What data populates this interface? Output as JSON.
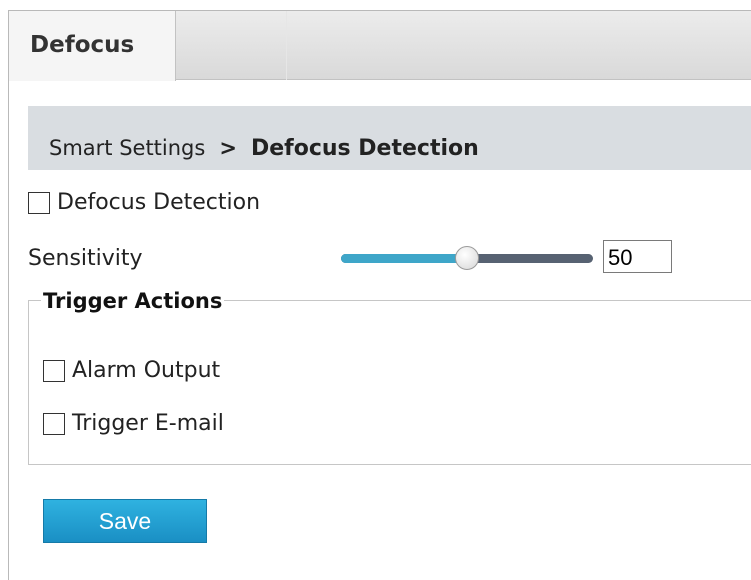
{
  "tabs": [
    {
      "label": "Defocus",
      "active": true
    }
  ],
  "breadcrumb": {
    "parent": "Smart Settings",
    "separator": ">",
    "current": "Defocus Detection"
  },
  "defocus_detection": {
    "label": "Defocus Detection",
    "checked": false
  },
  "sensitivity": {
    "label": "Sensitivity",
    "value": "50",
    "min": 0,
    "max": 100
  },
  "trigger_actions": {
    "legend": "Trigger Actions",
    "items": [
      {
        "label": "Alarm Output",
        "checked": false
      },
      {
        "label": "Trigger E-mail",
        "checked": false
      }
    ]
  },
  "save_label": "Save",
  "colors": {
    "accent": "#1a8fc4",
    "slider_fill": "#3ea6c9",
    "slider_track": "#576272",
    "breadcrumb_bg": "#d9dde1"
  }
}
